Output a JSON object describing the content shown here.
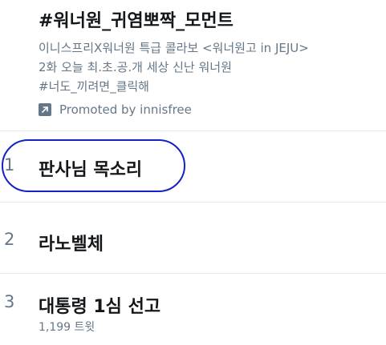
{
  "promoted_trend": {
    "title": "#워너원_귀염뽀짝_모먼트",
    "description_lines": [
      "이니스프리X워너원 특급 콜라보 <워너원고 in JEJU>",
      "2화 오늘 최.초.공.개 세상 신난 워너원",
      "#너도_끼려면_클릭해"
    ],
    "promoted_label": "Promoted by innisfree",
    "promoted_icon": "arrow-up-right-icon"
  },
  "trends": [
    {
      "rank": "1",
      "name": "판사님 목소리",
      "tweet_count": ""
    },
    {
      "rank": "2",
      "name": "라노벨체",
      "tweet_count": ""
    },
    {
      "rank": "3",
      "name": "대통령 1심 선고",
      "tweet_count": "1,199 트윗"
    }
  ],
  "annotation": {
    "color": "#1322c4"
  }
}
